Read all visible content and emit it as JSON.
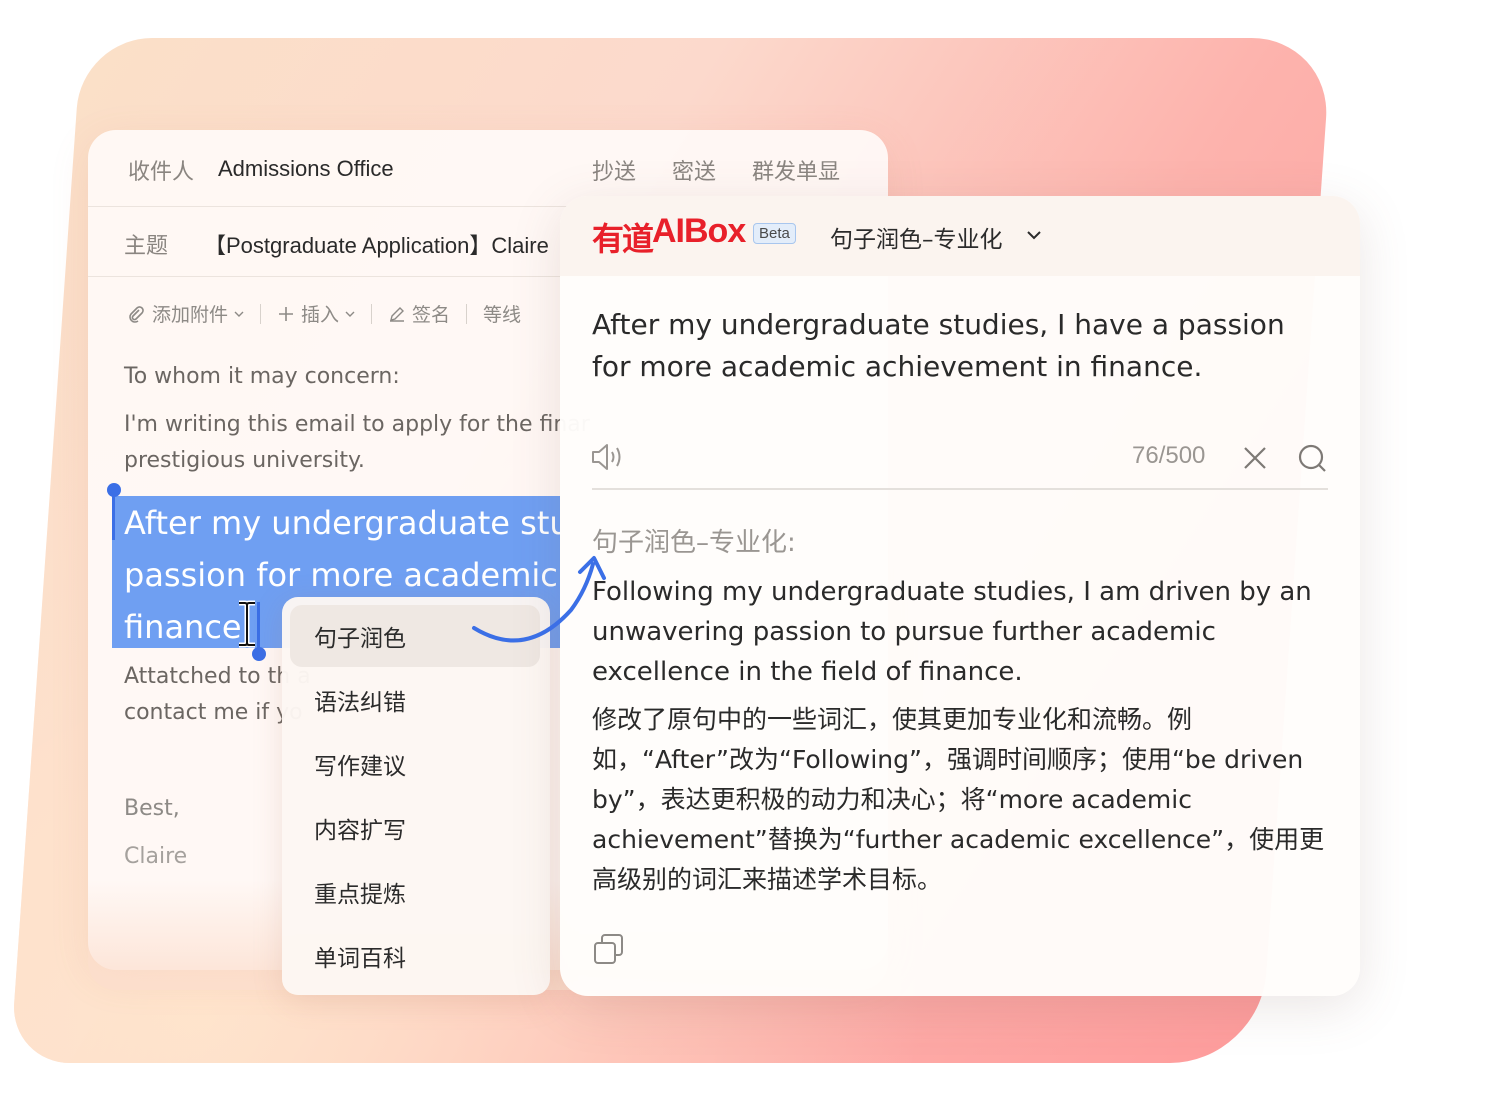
{
  "email": {
    "recipient_label": "收件人",
    "recipient_value": "Admissions Office",
    "cc_label": "抄送",
    "bcc_label": "密送",
    "group_label": "群发单显",
    "subject_label": "主题",
    "subject_value": "【Postgraduate Application】Claire",
    "toolbar": {
      "attach": "添加附件",
      "insert": "插入",
      "signature": "签名",
      "width": "等线"
    },
    "body": {
      "greeting": "To whom it may concern:",
      "line1": "I'm writing this email to apply for the finar",
      "line2": "prestigious university.",
      "selected_line1": "After my undergraduate stud",
      "selected_line2": "passion for more academic   a",
      "selected_line3": "finance.",
      "line3": "Attatched to th                              a",
      "line4": "contact me if yo",
      "closing": "Best,",
      "signature": "Claire"
    }
  },
  "context_menu": {
    "items": [
      "句子润色",
      "语法纠错",
      "写作建议",
      "内容扩写",
      "重点提炼",
      "单词百科"
    ],
    "active_index": 0
  },
  "aibox": {
    "logo_cn": "有道",
    "logo_en": "AIBox",
    "beta": "Beta",
    "mode": "句子润色–专业化",
    "input_text": "After my undergraduate studies, I have a passion for more academic achievement in finance.",
    "counter": "76/500",
    "result_label": "句子润色–专业化:",
    "result_en": "Following my undergraduate studies, I am driven by an unwavering passion to pursue further academic excellence in the field of finance.",
    "result_cn": "修改了原句中的一些词汇，使其更加专业化和流畅。例如，“After”改为“Following”，强调时间顺序；使用“be driven by”，表达更积极的动力和决心；将“more academic achievement”替换为“further academic excellence”，使用更高级别的词汇来描述学术目标。"
  },
  "colors": {
    "accent_blue": "#3b6fe6",
    "selection": "#6f9ff2",
    "brand_red": "#e8202a"
  }
}
